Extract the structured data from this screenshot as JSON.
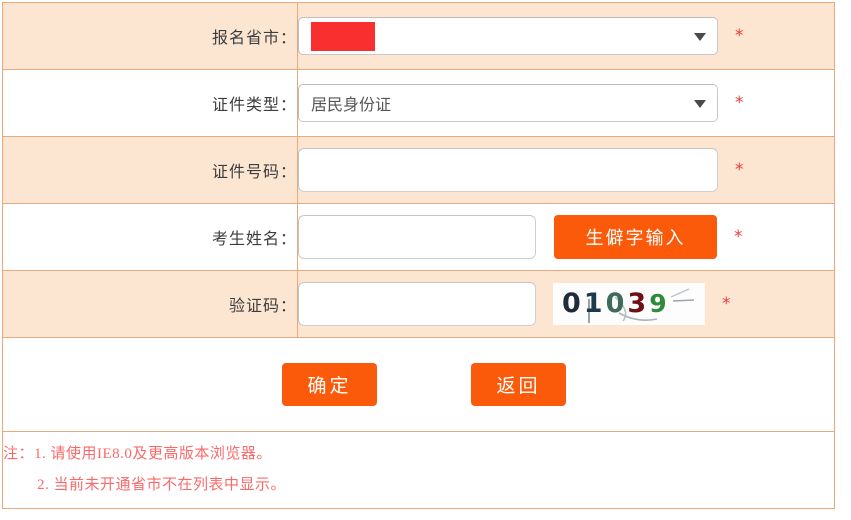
{
  "form": {
    "rows": [
      {
        "label": "报名省市：",
        "control": "select",
        "value": "",
        "redacted": true,
        "required_marker": "*"
      },
      {
        "label": "证件类型：",
        "control": "select",
        "value": "居民身份证",
        "redacted": false,
        "required_marker": "*"
      },
      {
        "label": "证件号码：",
        "control": "input",
        "value": "",
        "placeholder": "",
        "required_marker": "*"
      },
      {
        "label": "考生姓名：",
        "control": "input-with-button",
        "value": "",
        "placeholder": "",
        "button_label": "生僻字输入",
        "required_marker": "*"
      },
      {
        "label": "验证码：",
        "control": "input-with-captcha",
        "value": "",
        "placeholder": "",
        "captcha_text": "01039",
        "required_marker": "*"
      }
    ]
  },
  "actions": {
    "submit_label": "确定",
    "back_label": "返回"
  },
  "notes": {
    "prefix": "注：",
    "items": [
      "1. 请使用IE8.0及更高版本浏览器。",
      "2. 当前未开通省市不在列表中显示。"
    ]
  },
  "colors": {
    "row_shaded": "#fce6d2",
    "table_border": "#e8aa7c",
    "button_orange": "#fa5a0a",
    "required_red": "#ef3b3b",
    "note_red": "#fa6a6a",
    "redaction_red": "#f92f2f"
  }
}
